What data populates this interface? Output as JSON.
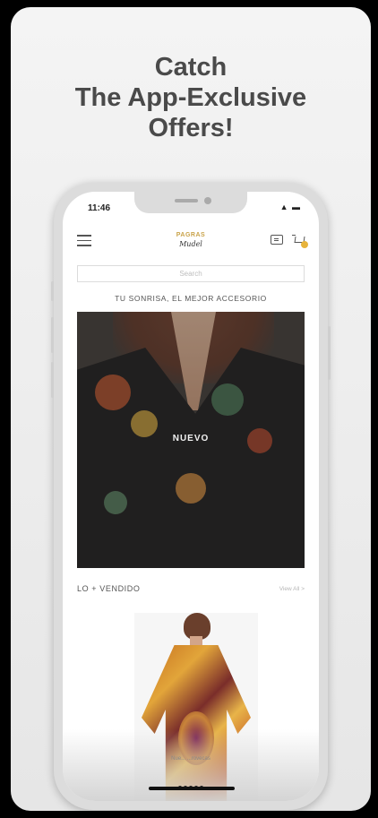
{
  "headline": {
    "line1": "Catch",
    "line2": "The App-Exclusive",
    "line3": "Offers!"
  },
  "status_bar": {
    "time": "11:46",
    "icons": "▲ ▬"
  },
  "navbar": {
    "logo_line1": "PAGRAS",
    "logo_line2": "Mudel"
  },
  "search": {
    "placeholder": "Search"
  },
  "promo": {
    "text": "TU SONRISA, EL MEJOR ACCESORIO"
  },
  "hero": {
    "label": "NUEVO"
  },
  "best_sellers": {
    "title": "LO + VENDIDO",
    "view_all": "View All >"
  },
  "bottom": {
    "caption": "Nue... ...rovecas"
  },
  "colors": {
    "accent": "#e7b43c",
    "text": "#4a4a4a"
  },
  "icons": [
    "menu-icon",
    "chat-icon",
    "cart-icon"
  ]
}
